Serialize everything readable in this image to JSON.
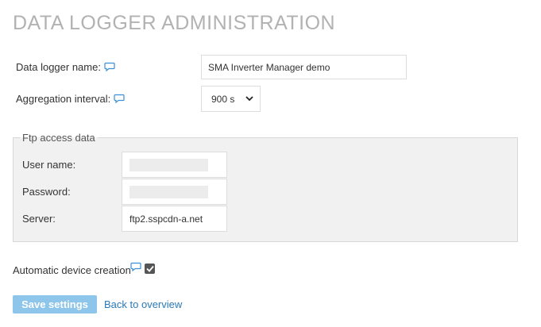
{
  "page": {
    "title": "DATA LOGGER ADMINISTRATION"
  },
  "logger": {
    "name_label": "Data logger name:",
    "name_value": "SMA Inverter Manager demo",
    "interval_label": "Aggregation interval:",
    "interval_value": "900 s"
  },
  "ftp": {
    "legend": "Ftp access data",
    "username_label": "User name:",
    "password_label": "Password:",
    "server_label": "Server:",
    "server_value": "ftp2.sspcdn-a.net"
  },
  "auto_device": {
    "label": "Automatic device creation",
    "checked": true
  },
  "actions": {
    "save_label": "Save settings",
    "back_label": "Back to overview"
  },
  "colors": {
    "help_icon": "#3a8fd6",
    "save_button": "#8ec5ea",
    "link": "#2a7ab9",
    "title": "#b2b2b2"
  },
  "icons": {
    "help": "speech-bubble-icon",
    "dropdown": "chevron-down-icon",
    "check": "check-icon"
  }
}
